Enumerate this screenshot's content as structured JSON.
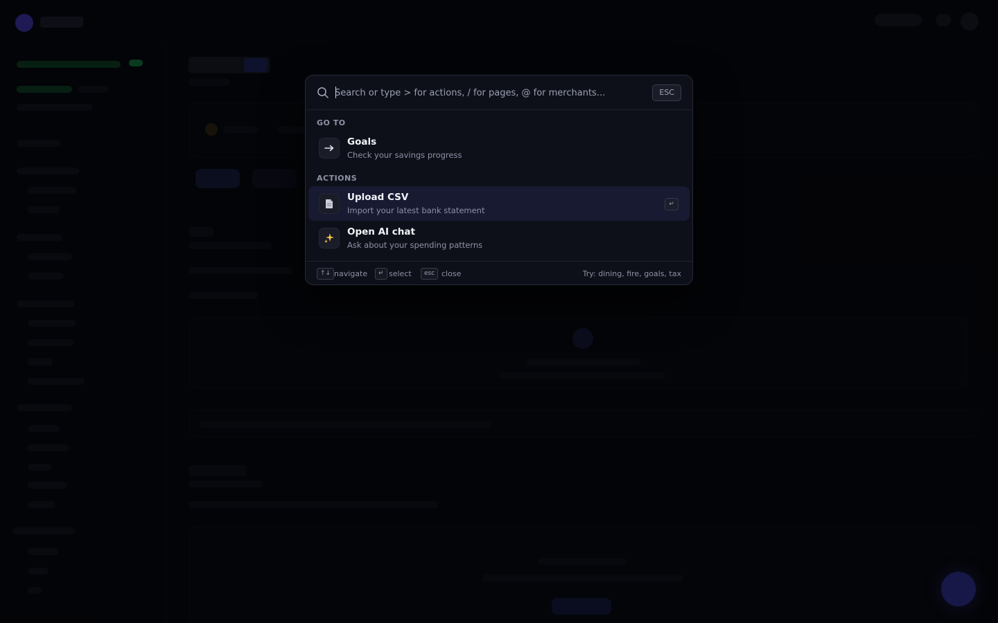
{
  "palette": {
    "search": {
      "placeholder": "Search or type > for actions, / for pages, @ for merchants...",
      "value": "",
      "esc_label": "ESC"
    },
    "sections": [
      {
        "label": "GO TO",
        "items": [
          {
            "icon": "arrow-right-icon",
            "title": "Goals",
            "subtitle": "Check your savings progress"
          }
        ]
      },
      {
        "label": "ACTIONS",
        "items": [
          {
            "icon": "document-icon",
            "title": "Upload CSV",
            "subtitle": "Import your latest bank statement",
            "active": true,
            "enter_label": "↵"
          },
          {
            "icon": "sparkle-icon",
            "title": "Open AI chat",
            "subtitle": "Ask about your spending patterns"
          }
        ]
      }
    ],
    "footer": {
      "navigate_key": "↑↓",
      "navigate_label": "navigate",
      "select_key": "↵",
      "select_label": "select",
      "close_key": "esc",
      "close_label": "close",
      "hint": "Try: dining, fire, goals, tax"
    },
    "colors": {
      "active_row": "#171a30",
      "sparkle": "#f5c542",
      "background": "#07080d"
    }
  }
}
